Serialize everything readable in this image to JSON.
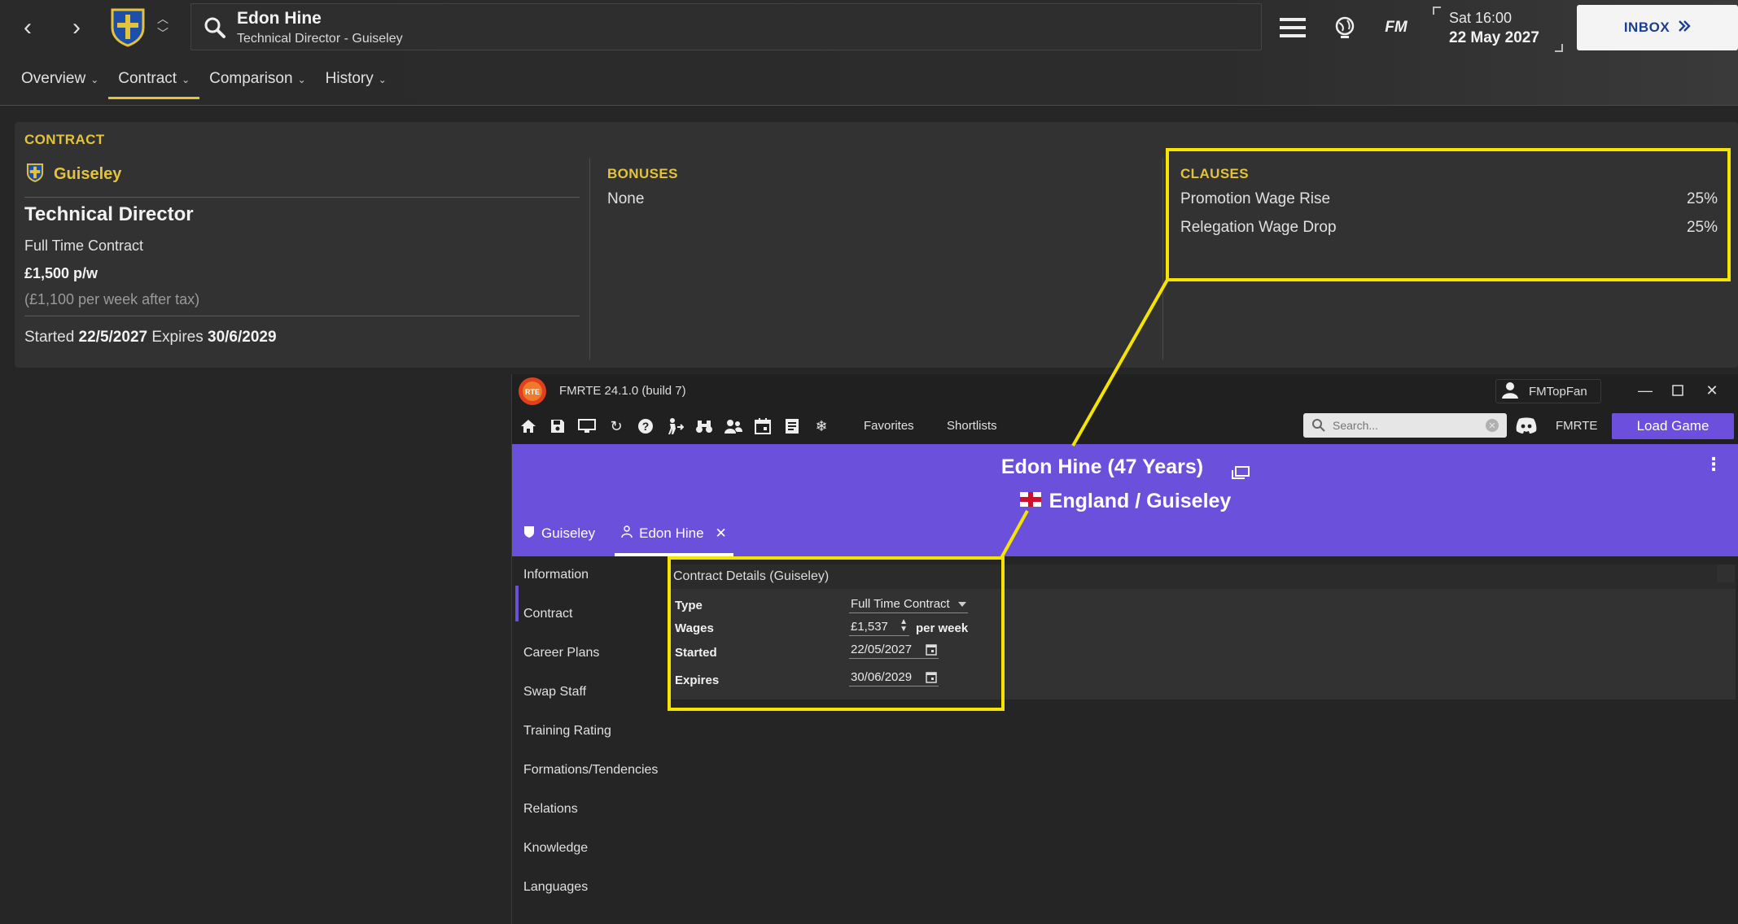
{
  "fm": {
    "person_name": "Edon Hine",
    "person_role": "Technical Director - Guiseley",
    "fm_logo": "FM",
    "time": "Sat 16:00",
    "date": "22 May 2027",
    "inbox_label": "INBOX",
    "tabs": [
      {
        "label": "Overview"
      },
      {
        "label": "Contract"
      },
      {
        "label": "Comparison"
      },
      {
        "label": "History"
      }
    ],
    "contract": {
      "section_title": "CONTRACT",
      "club": "Guiseley",
      "role": "Technical Director",
      "type": "Full Time Contract",
      "wage": "£1,500 p/w",
      "after_tax": "(£1,100 per week after tax)",
      "started_label": "Started",
      "started": "22/5/2027",
      "expires_label": "Expires",
      "expires": "30/6/2029"
    },
    "bonuses": {
      "title": "BONUSES",
      "value": "None"
    },
    "clauses": {
      "title": "CLAUSES",
      "rows": [
        {
          "label": "Promotion Wage Rise",
          "value": "25%"
        },
        {
          "label": "Relegation Wage Drop",
          "value": "25%"
        }
      ]
    }
  },
  "rte": {
    "window_title": "FMRTE 24.1.0 (build 7)",
    "username": "FMTopFan",
    "toolbar_links": [
      "Favorites",
      "Shortlists"
    ],
    "search_placeholder": "Search...",
    "fmrte_link": "FMRTE",
    "load_game": "Load Game",
    "header_name": "Edon Hine (47 Years)",
    "header_nation": "England / Guiseley",
    "tabs": [
      {
        "label": "Guiseley"
      },
      {
        "label": "Edon Hine",
        "close": "✕"
      }
    ],
    "sidebar": [
      "Information",
      "Contract",
      "Career Plans",
      "Swap Staff",
      "Training Rating",
      "Formations/Tendencies",
      "Relations",
      "Knowledge",
      "Languages"
    ],
    "contract_details": {
      "title": "Contract Details (Guiseley)",
      "type_label": "Type",
      "type_value": "Full Time Contract",
      "wages_label": "Wages",
      "wages_value": "£1,537",
      "wages_unit": "per week",
      "started_label": "Started",
      "started_value": "22/05/2027",
      "expires_label": "Expires",
      "expires_value": "30/06/2029"
    }
  },
  "colors": {
    "fm_accent": "#e4c33c",
    "rte_purple": "#6b50dc",
    "highlight": "#f5e400",
    "inbox_text": "#1d3f8f"
  }
}
